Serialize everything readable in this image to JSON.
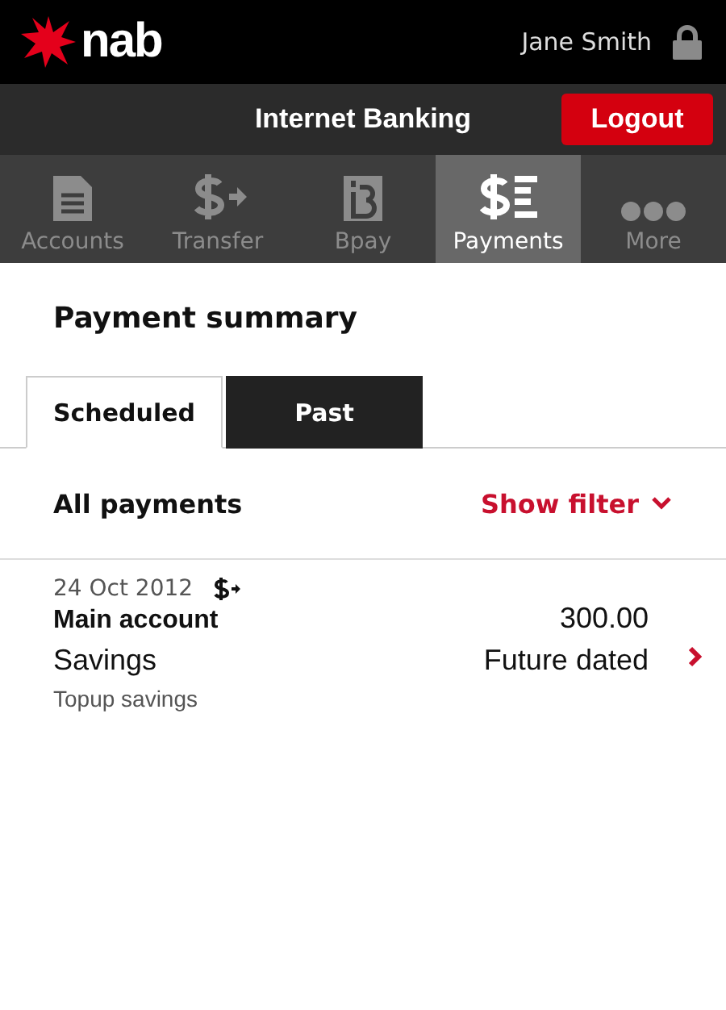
{
  "header": {
    "logo": "nab",
    "user": "Jane Smith"
  },
  "bar": {
    "title": "Internet Banking",
    "logout": "Logout"
  },
  "nav": [
    {
      "kind": "accounts",
      "label": "Accounts",
      "selected": false
    },
    {
      "kind": "transfer",
      "label": "Transfer",
      "selected": false
    },
    {
      "kind": "bpay",
      "label": "Bpay",
      "selected": false
    },
    {
      "kind": "payments",
      "label": "Payments",
      "selected": true
    },
    {
      "kind": "more",
      "label": "More",
      "selected": false
    }
  ],
  "page_title": "Payment summary",
  "tabs": [
    {
      "label": "Scheduled",
      "selected": true
    },
    {
      "label": "Past",
      "selected": false
    }
  ],
  "filter_row": {
    "label": "All payments",
    "filter": "Show filter"
  },
  "payments": [
    {
      "date": "24 Oct 2012",
      "from": "Main account",
      "to": "Savings",
      "description": "Topup savings",
      "amount": "300.00",
      "status": "Future dated"
    }
  ]
}
